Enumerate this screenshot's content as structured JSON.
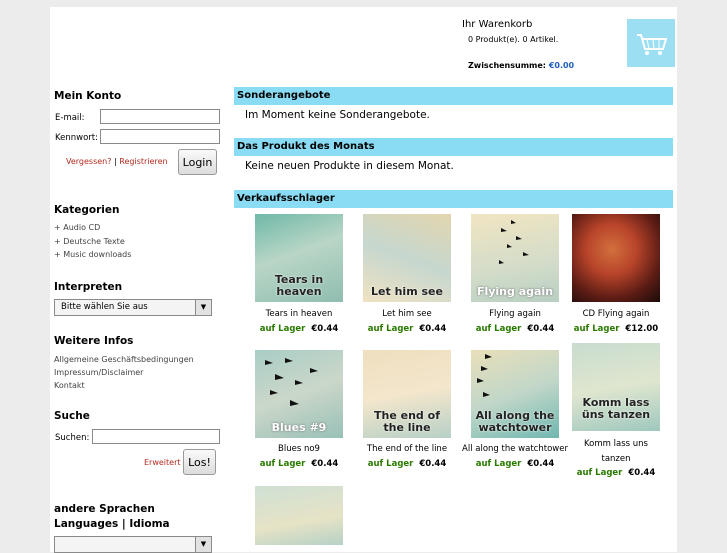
{
  "cart": {
    "title": "Ihr Warenkorb",
    "count": "0 Produkt(e). 0 Artikel.",
    "subtotal_label": "Zwischensumme:",
    "subtotal_value": "€0.00"
  },
  "account": {
    "title": "Mein Konto",
    "email_label": "E-mail:",
    "password_label": "Kennwort:",
    "forgot": "Vergessen?",
    "separator": "|",
    "register": "Registrieren",
    "login": "Login"
  },
  "categories": {
    "title": "Kategorien",
    "items": [
      "Audio CD",
      "Deutsche Texte",
      "Music downloads"
    ]
  },
  "artists": {
    "title": "Interpreten",
    "selected": "Bitte wählen Sie aus"
  },
  "infos": {
    "title": "Weitere Infos",
    "items": [
      "Allgemeine Geschäftsbedingungen",
      "Impressum/Disclaimer",
      "Kontakt"
    ]
  },
  "search": {
    "title": "Suche",
    "label": "Suchen:",
    "advanced": "Erweitert",
    "button": "Los!"
  },
  "languages": {
    "title_line1": "andere Sprachen",
    "title_line2": "Languages | Idioma"
  },
  "sections": {
    "specials_title": "Sonderangebote",
    "specials_msg": "Im Moment keine Sonderangebote.",
    "month_title": "Das Produkt des Monats",
    "month_msg": "Keine neuen Produkte in diesem Monat.",
    "bestsellers_title": "Verkaufsschlager"
  },
  "products": [
    {
      "name": "Tears in heaven",
      "caption": "Tears in heaven",
      "stock": "auf Lager",
      "price": "€0.44"
    },
    {
      "name": "Let him see",
      "caption": "Let him see",
      "stock": "auf Lager",
      "price": "€0.44"
    },
    {
      "name": "Flying again",
      "caption": "Flying again",
      "stock": "auf Lager",
      "price": "€0.44"
    },
    {
      "name": "CD Flying again",
      "caption": "",
      "stock": "auf Lager",
      "price": "€12.00"
    },
    {
      "name": "Blues no9",
      "caption": "Blues #9",
      "stock": "auf Lager",
      "price": "€0.44"
    },
    {
      "name": "The end of the line",
      "caption": "The end of the line",
      "stock": "auf Lager",
      "price": "€0.44"
    },
    {
      "name": "All along the watchtower",
      "caption": "All along the watchtower",
      "stock": "auf Lager",
      "price": "€0.44"
    },
    {
      "name": "Komm lass uns tanzen",
      "caption": "Komm lass üns tanzen",
      "stock": "auf Lager",
      "price": "€0.44"
    }
  ],
  "colors": {
    "section_bar": "#8adcf4",
    "in_stock": "#2a7a00",
    "link_red": "#b22b1f",
    "price_blue": "#1f5fbf"
  }
}
